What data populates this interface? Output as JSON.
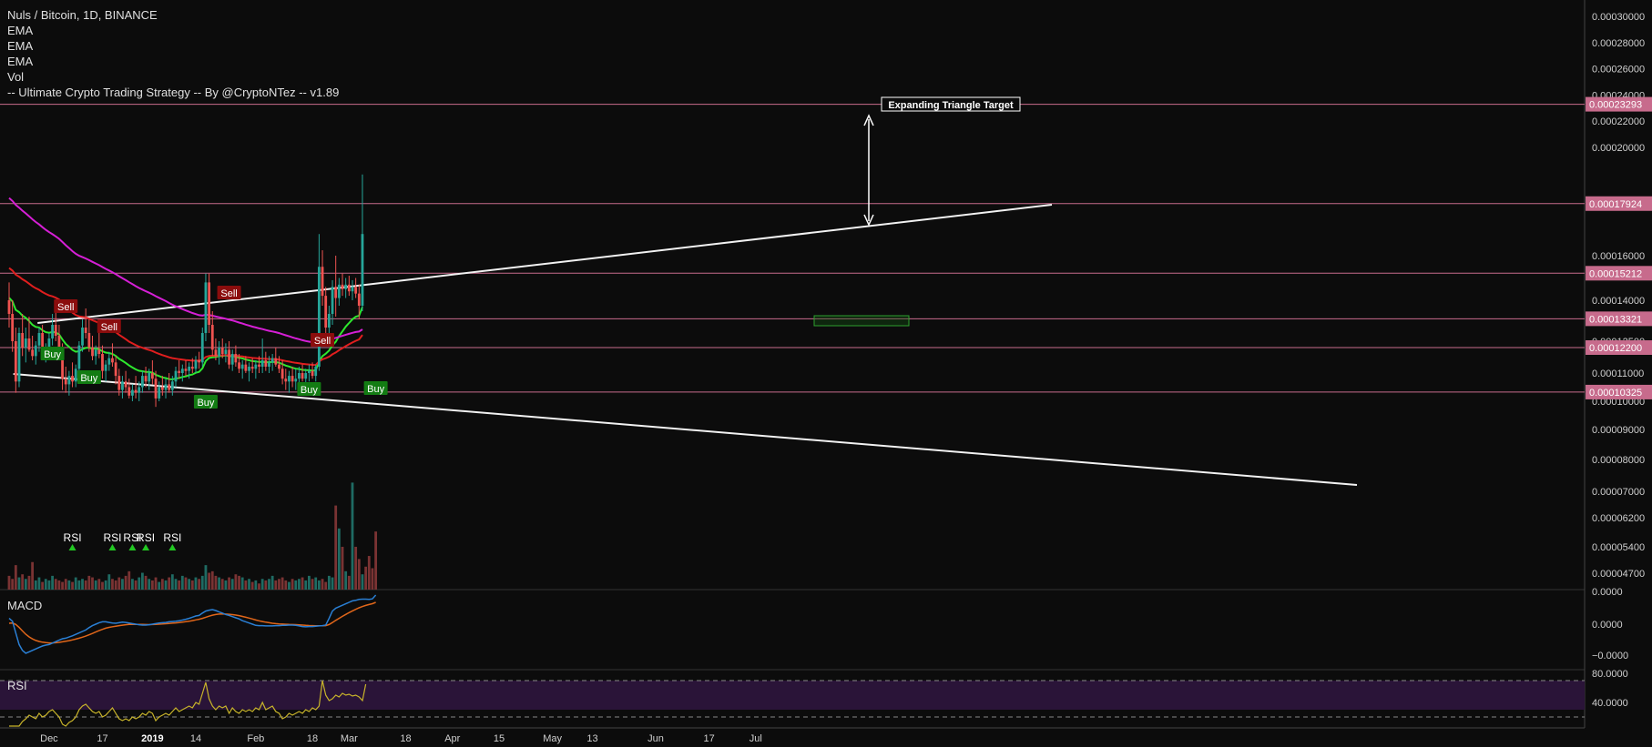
{
  "legend": {
    "title": "Nuls / Bitcoin, 1D, BINANCE",
    "lines": [
      "EMA",
      "EMA",
      "EMA",
      "Vol",
      "-- Ultimate Crypto Trading Strategy -- By @CryptoNTez -- v1.89"
    ]
  },
  "panes": {
    "macd_label": "MACD",
    "rsi_label": "RSI"
  },
  "colors": {
    "background": "#0c0c0c",
    "up": "#26a69a",
    "down": "#ef5350",
    "ema_fast": "#2ee82e",
    "ema_mid": "#e01e1e",
    "ema_slow": "#d61fd6",
    "hline": "#c76b8c",
    "price_tag": "#c76b8c",
    "trendline": "#f2f2f2",
    "macd": "#2a7fd4",
    "signal": "#e0661a",
    "rsi": "#c8b42a",
    "rsi_band": "#2a1438"
  },
  "chart_data": {
    "type": "candlestick",
    "pair": "Nuls / Bitcoin",
    "timeframe": "1D",
    "exchange": "BINANCE",
    "x_labels": [
      {
        "label": "Dec",
        "x": "2018-12-01"
      },
      {
        "label": "17",
        "x": "2018-12-17"
      },
      {
        "label": "2019",
        "x": "2019-01-01"
      },
      {
        "label": "14",
        "x": "2019-01-14"
      },
      {
        "label": "Feb",
        "x": "2019-02-01"
      },
      {
        "label": "18",
        "x": "2019-02-18"
      },
      {
        "label": "Mar",
        "x": "2019-03-01"
      },
      {
        "label": "18",
        "x": "2019-03-18"
      },
      {
        "label": "Apr",
        "x": "2019-04-01"
      },
      {
        "label": "15",
        "x": "2019-04-15"
      },
      {
        "label": "May",
        "x": "2019-05-01"
      },
      {
        "label": "13",
        "x": "2019-05-13"
      },
      {
        "label": "Jun",
        "x": "2019-06-01"
      },
      {
        "label": "17",
        "x": "2019-06-17"
      },
      {
        "label": "Jul",
        "x": "2019-07-01"
      }
    ],
    "price_axis_ticks": [
      "0.00030000",
      "0.00028000",
      "0.00026000",
      "0.00024000",
      "0.00022000",
      "0.00020000",
      "0.00016000",
      "0.00014000",
      "0.00012500",
      "0.00011000",
      "0.00010000",
      "0.00009000",
      "0.00008000",
      "0.00007000",
      "0.00006200",
      "0.00005400",
      "0.00004700"
    ],
    "price_tick_values": [
      0.0003,
      0.00028,
      0.00026,
      0.00024,
      0.00022,
      0.0002,
      0.00016,
      0.00014,
      0.000125,
      0.00011,
      0.0001,
      9e-05,
      8e-05,
      7e-05,
      6.2e-05,
      5.4e-05,
      4.7e-05
    ],
    "horizontal_levels": [
      "0.00023293",
      "0.00017924",
      "0.00015212",
      "0.00013321",
      "0.00012200",
      "0.00010325"
    ],
    "horizontal_level_values": [
      0.00023293,
      0.00017924,
      0.00015212,
      0.00013321,
      0.000122,
      0.00010325
    ],
    "annotation": "Expanding Triangle Target",
    "macd_axis_ticks": [
      "0.0000",
      "0.0000",
      "−0.0000"
    ],
    "rsi_axis_ticks": [
      "80.0000",
      "40.0000"
    ],
    "signals": [
      {
        "label": "Sell",
        "date": "2018-12-06"
      },
      {
        "label": "Sell",
        "date": "2018-12-19"
      },
      {
        "label": "Sell",
        "date": "2019-01-24"
      },
      {
        "label": "Sell",
        "date": "2019-02-21"
      },
      {
        "label": "Buy",
        "date": "2018-12-02"
      },
      {
        "label": "Buy",
        "date": "2018-12-13"
      },
      {
        "label": "Buy",
        "date": "2019-01-17"
      },
      {
        "label": "Buy",
        "date": "2019-02-17"
      },
      {
        "label": "Buy",
        "date": "2019-03-09"
      }
    ],
    "rsi_markers": [
      {
        "label": "RSI",
        "date": "2018-12-08"
      },
      {
        "label": "RSI",
        "date": "2018-12-20"
      },
      {
        "label": "RSI",
        "date": "2018-12-26"
      },
      {
        "label": "RSI",
        "date": "2018-12-30"
      },
      {
        "label": "RSI",
        "date": "2019-01-07"
      }
    ],
    "candle_start": "2018-11-19",
    "candles": [
      [
        0.00014,
        0.000148,
        0.00013,
        0.000135
      ],
      [
        0.000135,
        0.00014,
        0.00012,
        0.000125
      ],
      [
        0.000125,
        0.00013,
        0.000103,
        0.000107
      ],
      [
        0.000107,
        0.00013,
        0.000105,
        0.000128
      ],
      [
        0.000128,
        0.000135,
        0.000118,
        0.000122
      ],
      [
        0.000122,
        0.00013,
        0.000115,
        0.000126
      ],
      [
        0.000126,
        0.000134,
        0.00012,
        0.000121
      ],
      [
        0.000121,
        0.000127,
        0.000116,
        0.000118
      ],
      [
        0.000118,
        0.000125,
        0.000114,
        0.000123
      ],
      [
        0.000123,
        0.00013,
        0.00012,
        0.000128
      ],
      [
        0.000128,
        0.000131,
        0.000118,
        0.000119
      ],
      [
        0.000119,
        0.000124,
        0.000115,
        0.000122
      ],
      [
        0.000122,
        0.000128,
        0.000119,
        0.000126
      ],
      [
        0.000126,
        0.000135,
        0.000123,
        0.000131
      ],
      [
        0.000131,
        0.000138,
        0.000125,
        0.000127
      ],
      [
        0.000127,
        0.000131,
        0.000118,
        0.00012
      ],
      [
        0.00012,
        0.000124,
        0.000104,
        0.000108
      ],
      [
        0.000108,
        0.000113,
        0.000103,
        0.000106
      ],
      [
        0.000106,
        0.000111,
        0.000102,
        0.000109
      ],
      [
        0.000109,
        0.000115,
        0.000105,
        0.000107
      ],
      [
        0.000107,
        0.000114,
        0.000105,
        0.000112
      ],
      [
        0.000112,
        0.000125,
        0.00011,
        0.000123
      ],
      [
        0.000123,
        0.000133,
        0.00012,
        0.00013
      ],
      [
        0.00013,
        0.000137,
        0.000126,
        0.000128
      ],
      [
        0.000128,
        0.000133,
        0.00012,
        0.000122
      ],
      [
        0.000122,
        0.000127,
        0.000116,
        0.000118
      ],
      [
        0.000118,
        0.000123,
        0.000114,
        0.000121
      ],
      [
        0.000121,
        0.000128,
        0.000117,
        0.000119
      ],
      [
        0.000119,
        0.000123,
        0.000108,
        0.000111
      ],
      [
        0.000111,
        0.000116,
        0.000107,
        0.000114
      ],
      [
        0.000114,
        0.00012,
        0.000111,
        0.000117
      ],
      [
        0.000117,
        0.000124,
        0.000113,
        0.000115
      ],
      [
        0.000115,
        0.000118,
        0.000106,
        0.000109
      ],
      [
        0.000109,
        0.000112,
        0.000102,
        0.000104
      ],
      [
        0.000104,
        0.000109,
        0.000101,
        0.000107
      ],
      [
        0.000107,
        0.000111,
        0.000103,
        0.000105
      ],
      [
        0.000105,
        0.000108,
        0.000101,
        0.000102
      ],
      [
        0.000102,
        0.000106,
        0.0001,
        0.000104
      ],
      [
        0.000104,
        0.000109,
        0.000101,
        0.000103
      ],
      [
        0.000103,
        0.000107,
        0.0001,
        0.000105
      ],
      [
        0.000105,
        0.000111,
        0.000103,
        0.000109
      ],
      [
        0.000109,
        0.000113,
        0.000105,
        0.000107
      ],
      [
        0.000107,
        0.000112,
        0.000104,
        0.00011
      ],
      [
        0.00011,
        0.000116,
        0.000106,
        0.000108
      ],
      [
        0.000108,
        0.000111,
        9.8e-05,
        0.000101
      ],
      [
        0.000101,
        0.000107,
        0.0001,
        0.000105
      ],
      [
        0.000105,
        0.000109,
        0.000102,
        0.000104
      ],
      [
        0.000104,
        0.000108,
        0.000101,
        0.000106
      ],
      [
        0.000106,
        0.00011,
        0.000103,
        0.000104
      ],
      [
        0.000104,
        0.000109,
        0.000102,
        0.000107
      ],
      [
        0.000107,
        0.000113,
        0.000105,
        0.000111
      ],
      [
        0.000111,
        0.000116,
        0.000108,
        0.00011
      ],
      [
        0.00011,
        0.000114,
        0.000107,
        0.000112
      ],
      [
        0.000112,
        0.000116,
        0.000109,
        0.000111
      ],
      [
        0.000111,
        0.000115,
        0.000108,
        0.000113
      ],
      [
        0.000113,
        0.000117,
        0.00011,
        0.000112
      ],
      [
        0.000112,
        0.000118,
        0.00011,
        0.000116
      ],
      [
        0.000116,
        0.00012,
        0.000112,
        0.000115
      ],
      [
        0.000115,
        0.00013,
        0.000113,
        0.000128
      ],
      [
        0.000128,
        0.000152,
        0.000125,
        0.000148
      ],
      [
        0.000148,
        0.000152,
        0.000128,
        0.000131
      ],
      [
        0.000131,
        0.000136,
        0.000118,
        0.000121
      ],
      [
        0.000121,
        0.000126,
        0.000116,
        0.000118
      ],
      [
        0.000118,
        0.000125,
        0.000114,
        0.000122
      ],
      [
        0.000122,
        0.000126,
        0.000117,
        0.000119
      ],
      [
        0.000119,
        0.000124,
        0.000115,
        0.000121
      ],
      [
        0.000121,
        0.000125,
        0.000112,
        0.000114
      ],
      [
        0.000114,
        0.000121,
        0.000111,
        0.000119
      ],
      [
        0.000119,
        0.000123,
        0.000113,
        0.000115
      ],
      [
        0.000115,
        0.000119,
        0.00011,
        0.000112
      ],
      [
        0.000112,
        0.000116,
        0.000108,
        0.000114
      ],
      [
        0.000114,
        0.000118,
        0.00011,
        0.000111
      ],
      [
        0.000111,
        0.000115,
        0.000107,
        0.000113
      ],
      [
        0.000113,
        0.000117,
        0.00011,
        0.000112
      ],
      [
        0.000112,
        0.000116,
        0.000108,
        0.000114
      ],
      [
        0.000114,
        0.000118,
        0.00011,
        0.000113
      ],
      [
        0.000113,
        0.000126,
        0.00011,
        0.000116
      ],
      [
        0.000116,
        0.00012,
        0.000111,
        0.000113
      ],
      [
        0.000113,
        0.000118,
        0.00011,
        0.000115
      ],
      [
        0.000115,
        0.000119,
        0.000111,
        0.000117
      ],
      [
        0.000117,
        0.000122,
        0.000113,
        0.000114
      ],
      [
        0.000114,
        0.000118,
        0.00011,
        0.000112
      ],
      [
        0.000112,
        0.000116,
        0.000106,
        0.000108
      ],
      [
        0.000108,
        0.000112,
        0.000104,
        0.000107
      ],
      [
        0.000107,
        0.000111,
        0.000103,
        0.000109
      ],
      [
        0.000109,
        0.000113,
        0.000105,
        0.000107
      ],
      [
        0.000107,
        0.000112,
        0.000104,
        0.000108
      ],
      [
        0.000108,
        0.000113,
        0.000105,
        0.00011
      ],
      [
        0.00011,
        0.000114,
        0.000107,
        0.000108
      ],
      [
        0.000108,
        0.000112,
        0.000105,
        0.00011
      ],
      [
        0.00011,
        0.000114,
        0.000107,
        0.000111
      ],
      [
        0.000111,
        0.000115,
        0.000108,
        0.000109
      ],
      [
        0.000109,
        0.000114,
        0.000107,
        0.000113
      ],
      [
        0.000113,
        0.000168,
        0.000111,
        0.000155
      ],
      [
        0.000155,
        0.000162,
        0.000138,
        0.000142
      ],
      [
        0.000142,
        0.000146,
        0.000126,
        0.00013
      ],
      [
        0.00013,
        0.000138,
        0.000124,
        0.000135
      ],
      [
        0.000135,
        0.000149,
        0.000131,
        0.000146
      ],
      [
        0.000146,
        0.00016,
        0.000134,
        0.000141
      ],
      [
        0.000141,
        0.00015,
        0.000138,
        0.000147
      ],
      [
        0.000147,
        0.000152,
        0.000142,
        0.000145
      ],
      [
        0.000145,
        0.00015,
        0.000141,
        0.000147
      ],
      [
        0.000147,
        0.000151,
        0.000142,
        0.000144
      ],
      [
        0.000144,
        0.000149,
        0.00014,
        0.000146
      ],
      [
        0.000146,
        0.00015,
        0.000141,
        0.000143
      ],
      [
        0.000143,
        0.000147,
        0.000133,
        0.000138
      ],
      [
        0.000138,
        0.00019,
        0.000136,
        0.000168
      ]
    ],
    "volumes": [
      9,
      7,
      16,
      8,
      10,
      7,
      9,
      18,
      6,
      8,
      5,
      7,
      6,
      9,
      7,
      6,
      5,
      7,
      6,
      5,
      8,
      6,
      7,
      6,
      9,
      8,
      6,
      7,
      5,
      6,
      10,
      7,
      6,
      8,
      7,
      9,
      12,
      7,
      6,
      8,
      11,
      9,
      7,
      6,
      8,
      5,
      7,
      6,
      8,
      10,
      7,
      6,
      9,
      8,
      7,
      6,
      8,
      7,
      9,
      16,
      11,
      12,
      9,
      8,
      7,
      6,
      8,
      7,
      10,
      9,
      8,
      6,
      7,
      5,
      6,
      4,
      7,
      6,
      7,
      9,
      6,
      7,
      8,
      6,
      5,
      7,
      6,
      7,
      8,
      6,
      9,
      7,
      8,
      6,
      7,
      5,
      9,
      8,
      55,
      40,
      28,
      12,
      9,
      70,
      28,
      20,
      10,
      15,
      22,
      14,
      38
    ],
    "macd_series": [
      0.2,
      0.1,
      -0.3,
      -0.7,
      -0.9,
      -1.0,
      -0.95,
      -0.9,
      -0.85,
      -0.8,
      -0.75,
      -0.72,
      -0.7,
      -0.65,
      -0.6,
      -0.55,
      -0.5,
      -0.48,
      -0.44,
      -0.4,
      -0.35,
      -0.3,
      -0.25,
      -0.2,
      -0.12,
      -0.05,
      0.0,
      0.05,
      0.08,
      0.08,
      0.06,
      0.04,
      0.03,
      0.05,
      0.07,
      0.06,
      0.04,
      0.02,
      0.0,
      -0.02,
      -0.03,
      -0.03,
      -0.02,
      0.0,
      0.02,
      0.04,
      0.05,
      0.06,
      0.08,
      0.09,
      0.1,
      0.12,
      0.14,
      0.17,
      0.2,
      0.24,
      0.28,
      0.3,
      0.38,
      0.45,
      0.48,
      0.5,
      0.47,
      0.42,
      0.38,
      0.33,
      0.3,
      0.26,
      0.22,
      0.18,
      0.12,
      0.08,
      0.04,
      0.0,
      -0.04,
      -0.05,
      -0.05,
      -0.06,
      -0.06,
      -0.06,
      -0.05,
      -0.05,
      -0.04,
      -0.04,
      -0.03,
      -0.03,
      -0.04,
      -0.06,
      -0.08,
      -0.09,
      -0.08,
      -0.08,
      -0.07,
      -0.06,
      -0.05,
      -0.03,
      0.2,
      0.45,
      0.55,
      0.6,
      0.65,
      0.7,
      0.75,
      0.8,
      0.82,
      0.85,
      0.86,
      0.86,
      0.85,
      0.87,
      1.0
    ],
    "rsi_series": [
      30,
      28,
      20,
      22,
      35,
      38,
      42,
      40,
      38,
      44,
      40,
      42,
      46,
      48,
      44,
      40,
      32,
      30,
      34,
      36,
      40,
      48,
      52,
      54,
      50,
      46,
      44,
      46,
      40,
      42,
      46,
      50,
      44,
      38,
      36,
      38,
      36,
      40,
      38,
      40,
      44,
      42,
      46,
      44,
      36,
      40,
      42,
      44,
      42,
      46,
      50,
      46,
      48,
      50,
      52,
      50,
      56,
      54,
      66,
      78,
      60,
      52,
      48,
      52,
      50,
      52,
      44,
      50,
      46,
      44,
      48,
      46,
      48,
      46,
      50,
      48,
      56,
      48,
      50,
      52,
      46,
      44,
      38,
      40,
      44,
      42,
      44,
      46,
      44,
      48,
      46,
      50,
      48,
      52,
      80,
      64,
      58,
      60,
      64,
      62,
      66,
      64,
      65,
      63,
      64,
      62,
      58,
      76
    ]
  }
}
